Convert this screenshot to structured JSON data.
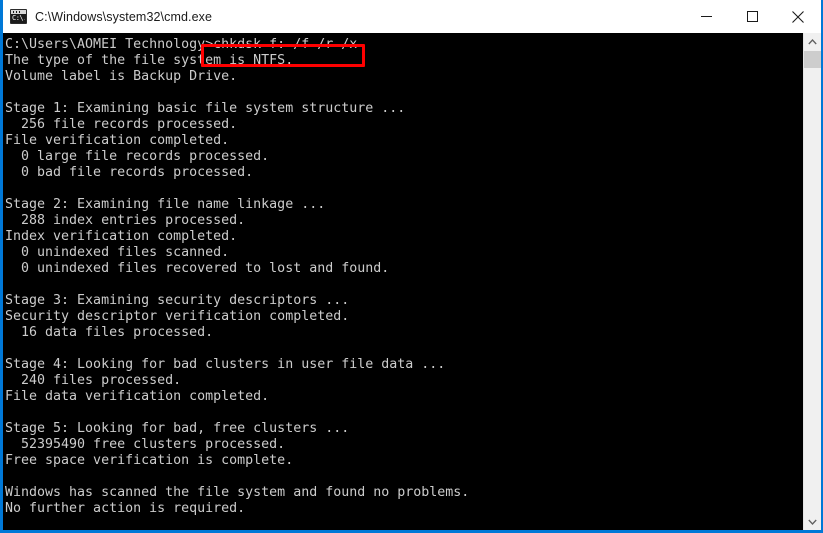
{
  "window": {
    "title": "C:\\Windows\\system32\\cmd.exe",
    "icon": "cmd-console-icon",
    "icon_glyph": "C:\\.",
    "accent_color": "#0078d7",
    "background_color": "#000000",
    "text_color": "#cccccc"
  },
  "controls": {
    "minimize_label": "Minimize",
    "maximize_label": "Maximize",
    "close_label": "Close"
  },
  "scrollbar": {
    "up_arrow": "scroll-up-arrow",
    "down_arrow": "scroll-down-arrow",
    "thumb": "scrollbar-thumb"
  },
  "annotation": {
    "color": "#fe0000",
    "target_text": ">chkdsk f: /f /r /x"
  },
  "console": {
    "prompt": "C:\\Users\\AOMEI Technology>",
    "command": "chkdsk f: /f /r /x",
    "lines": [
      "C:\\Users\\AOMEI Technology>chkdsk f: /f /r /x",
      "The type of the file system is NTFS.",
      "Volume label is Backup Drive.",
      "",
      "Stage 1: Examining basic file system structure ...",
      "  256 file records processed.",
      "File verification completed.",
      "  0 large file records processed.",
      "  0 bad file records processed.",
      "",
      "Stage 2: Examining file name linkage ...",
      "  288 index entries processed.",
      "Index verification completed.",
      "  0 unindexed files scanned.",
      "  0 unindexed files recovered to lost and found.",
      "",
      "Stage 3: Examining security descriptors ...",
      "Security descriptor verification completed.",
      "  16 data files processed.",
      "",
      "Stage 4: Looking for bad clusters in user file data ...",
      "  240 files processed.",
      "File data verification completed.",
      "",
      "Stage 5: Looking for bad, free clusters ...",
      "  52395490 free clusters processed.",
      "Free space verification is complete.",
      "",
      "Windows has scanned the file system and found no problems.",
      "No further action is required."
    ],
    "stats": {
      "file_system": "NTFS",
      "volume_label": "Backup Drive",
      "file_records_processed": "256",
      "large_file_records_processed": "0",
      "bad_file_records_processed": "0",
      "index_entries_processed": "288",
      "unindexed_files_scanned": "0",
      "unindexed_files_recovered": "0",
      "data_files_processed": "16",
      "files_processed": "240",
      "free_clusters_processed": "52395490"
    }
  }
}
